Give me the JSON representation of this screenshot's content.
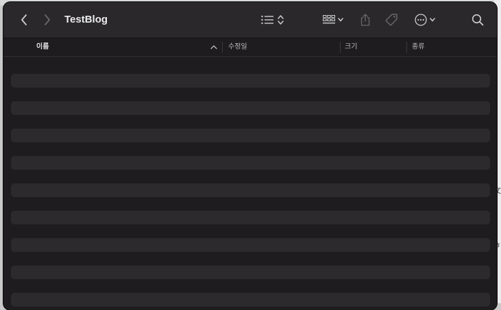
{
  "window": {
    "title": "TestBlog"
  },
  "toolbar": {
    "back_icon": "chevron-left-icon",
    "forward_icon": "chevron-right-icon",
    "view_list_icon": "list-icon",
    "group_icon": "grid-icon",
    "share_icon": "share-icon",
    "tag_icon": "tag-icon",
    "more_icon": "ellipsis-circle-icon",
    "search_icon": "search-icon"
  },
  "columns": [
    {
      "label": "이름",
      "sorted": "ascending"
    },
    {
      "label": "수정일"
    },
    {
      "label": "크기"
    },
    {
      "label": "종류"
    }
  ],
  "background": {
    "right_glyph_1": "文",
    "right_glyph_2": "ㅎ"
  },
  "colors": {
    "window_bg": "#1e1c1f",
    "toolbar_bg": "#2a282b",
    "row_bg": "#2c2a2d",
    "text": "#ececec"
  }
}
